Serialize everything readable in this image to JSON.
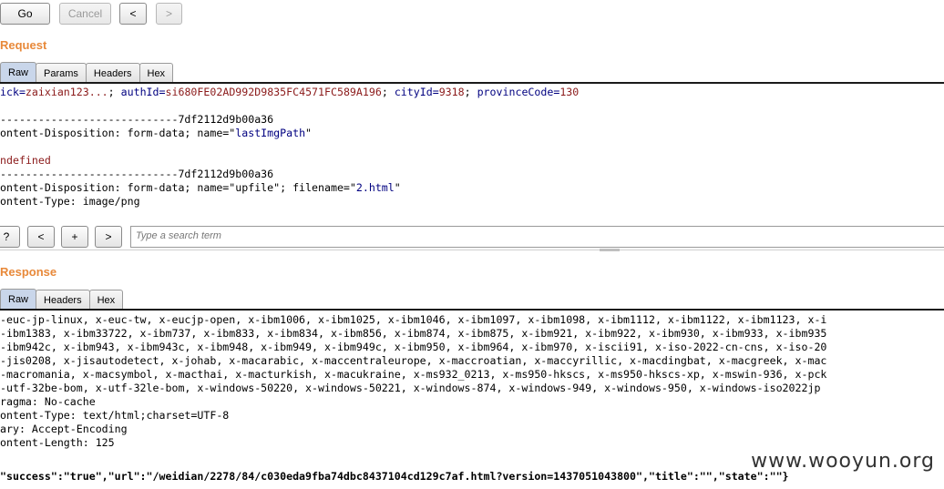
{
  "toolbar": {
    "go_label": "Go",
    "cancel_label": "Cancel",
    "back_label": "<",
    "forward_label": ">"
  },
  "request": {
    "title": "Request",
    "tabs": [
      {
        "label": "Raw",
        "active": true
      },
      {
        "label": "Params",
        "active": false
      },
      {
        "label": "Headers",
        "active": false
      },
      {
        "label": "Hex",
        "active": false
      }
    ],
    "lines": [
      {
        "parts": [
          {
            "t": "ick=",
            "c": "kw"
          },
          {
            "t": "zaixian123...",
            "c": "vl"
          },
          {
            "t": "; ",
            "c": ""
          },
          {
            "t": "authId=",
            "c": "kw"
          },
          {
            "t": "si680FE02AD992D9835FC4571FC589A196",
            "c": "vl"
          },
          {
            "t": "; ",
            "c": ""
          },
          {
            "t": "cityId=",
            "c": "kw"
          },
          {
            "t": "9318",
            "c": "vl"
          },
          {
            "t": "; ",
            "c": ""
          },
          {
            "t": "provinceCode=",
            "c": "kw"
          },
          {
            "t": "130",
            "c": "vl"
          }
        ]
      },
      {
        "parts": []
      },
      {
        "parts": [
          {
            "t": "----------------------------7df2112d9b00a36",
            "c": ""
          }
        ]
      },
      {
        "parts": [
          {
            "t": "ontent-Disposition: form-data; name=\"",
            "c": ""
          },
          {
            "t": "lastImgPath",
            "c": "kw"
          },
          {
            "t": "\"",
            "c": ""
          }
        ]
      },
      {
        "parts": []
      },
      {
        "parts": [
          {
            "t": "ndefined",
            "c": "red"
          }
        ]
      },
      {
        "parts": [
          {
            "t": "----------------------------7df2112d9b00a36",
            "c": ""
          }
        ]
      },
      {
        "parts": [
          {
            "t": "ontent-Disposition: form-data; name=\"upfile\"; filename=\"",
            "c": ""
          },
          {
            "t": "2.html",
            "c": "kw"
          },
          {
            "t": "\"",
            "c": ""
          }
        ]
      },
      {
        "parts": [
          {
            "t": "ontent-Type: image/png",
            "c": ""
          }
        ]
      }
    ]
  },
  "search": {
    "help_label": "?",
    "prev_label": "<",
    "add_label": "+",
    "next_label": ">",
    "placeholder": "Type a search term"
  },
  "response": {
    "title": "Response",
    "tabs": [
      {
        "label": "Raw",
        "active": true
      },
      {
        "label": "Headers",
        "active": false
      },
      {
        "label": "Hex",
        "active": false
      }
    ],
    "lines": [
      "-euc-jp-linux, x-euc-tw, x-eucjp-open, x-ibm1006, x-ibm1025, x-ibm1046, x-ibm1097, x-ibm1098, x-ibm1112, x-ibm1122, x-ibm1123, x-i",
      "-ibm1383, x-ibm33722, x-ibm737, x-ibm833, x-ibm834, x-ibm856, x-ibm874, x-ibm875, x-ibm921, x-ibm922, x-ibm930, x-ibm933, x-ibm935",
      "-ibm942c, x-ibm943, x-ibm943c, x-ibm948, x-ibm949, x-ibm949c, x-ibm950, x-ibm964, x-ibm970, x-iscii91, x-iso-2022-cn-cns, x-iso-20",
      "-jis0208, x-jisautodetect, x-johab, x-macarabic, x-maccentraleurope, x-maccroatian, x-maccyrillic, x-macdingbat, x-macgreek, x-mac",
      "-macromania, x-macsymbol, x-macthai, x-macturkish, x-macukraine, x-ms932_0213, x-ms950-hkscs, x-ms950-hkscs-xp, x-mswin-936, x-pck",
      "-utf-32be-bom, x-utf-32le-bom, x-windows-50220, x-windows-50221, x-windows-874, x-windows-949, x-windows-950, x-windows-iso2022jp",
      "ragma: No-cache",
      "ontent-Type: text/html;charset=UTF-8",
      "ary: Accept-Encoding",
      "ontent-Length: 125",
      "",
      "\"success\":\"true\",\"url\":\"/weidian/2278/84/c030eda9fba74dbc8437104cd129c7af.html?version=1437051043800\",\"title\":\"\",\"state\":\"\"}"
    ]
  },
  "watermark": "www.wooyun.org",
  "colors": {
    "section_title": "#e8893a",
    "key": "#000080",
    "value": "#8b1a1a",
    "active_tab": "#c9d6ea"
  }
}
